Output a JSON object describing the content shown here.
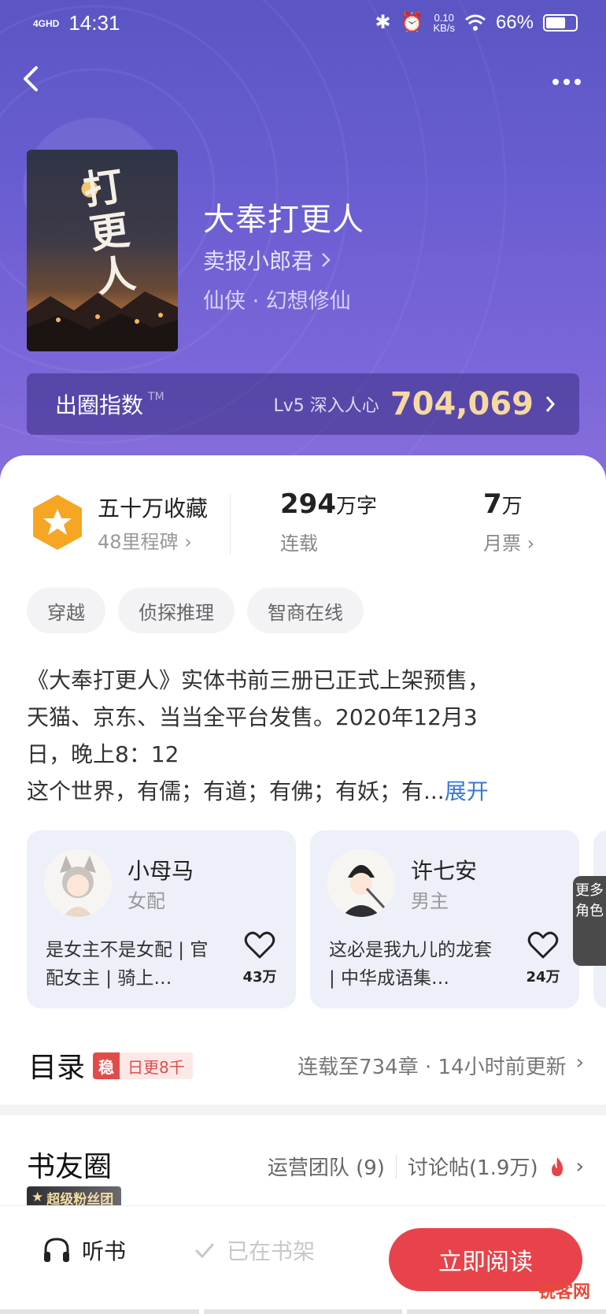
{
  "status_bar": {
    "network": "4GHD",
    "time": "14:31",
    "speed_value": "0.10",
    "speed_unit": "KB/s",
    "battery": "66%"
  },
  "book": {
    "title": "大奉打更人",
    "author": "卖报小郎君",
    "genre": "仙侠 · 幻想修仙",
    "cover_title": "打更人"
  },
  "popularity": {
    "label": "出圈指数",
    "tm": "TM",
    "level": "Lv5 深入人心",
    "value": "704,069"
  },
  "stats": {
    "collect_main": "五十万收藏",
    "collect_sub": "48里程碑",
    "words_num": "294",
    "words_unit": "万字",
    "words_sub": "连载",
    "votes_num": "7",
    "votes_unit": "万",
    "votes_sub": "月票"
  },
  "tags": [
    "穿越",
    "侦探推理",
    "智商在线"
  ],
  "description": {
    "lines": [
      "《大奉打更人》实体书前三册已正式上架预售，",
      "天猫、京东、当当全平台发售。2020年12月3",
      "日，晚上8：12",
      "这个世界，有儒；有道；有佛；有妖；有..."
    ],
    "expand": "展开"
  },
  "characters": [
    {
      "name": "小母马",
      "role": "女配",
      "desc": "是女主不是女配 | 官配女主 | 骑上…",
      "likes": "43万"
    },
    {
      "name": "许七安",
      "role": "男主",
      "desc": "这必是我九儿的龙套 | 中华成语集…",
      "likes": "24万"
    }
  ],
  "more_roles": "更多角色",
  "toc": {
    "title": "目录",
    "badge_icon": "稳",
    "badge_text": "日更8千",
    "status": "连载至734章 · 14小时前更新"
  },
  "circle": {
    "title": "书友圈",
    "fan_badge": "超级粉丝团",
    "team": "运营团队 (9)",
    "posts": "讨论帖(1.9万)"
  },
  "bottom": {
    "listen": "听书",
    "shelf": "已在书架",
    "read": "立即阅读"
  },
  "watermark": "锐客网",
  "colors": {
    "accent_red": "#e8434a",
    "link_blue": "#3a78d4",
    "hero_purple": "#6a5ed2",
    "gold": "#f6d9a0"
  }
}
